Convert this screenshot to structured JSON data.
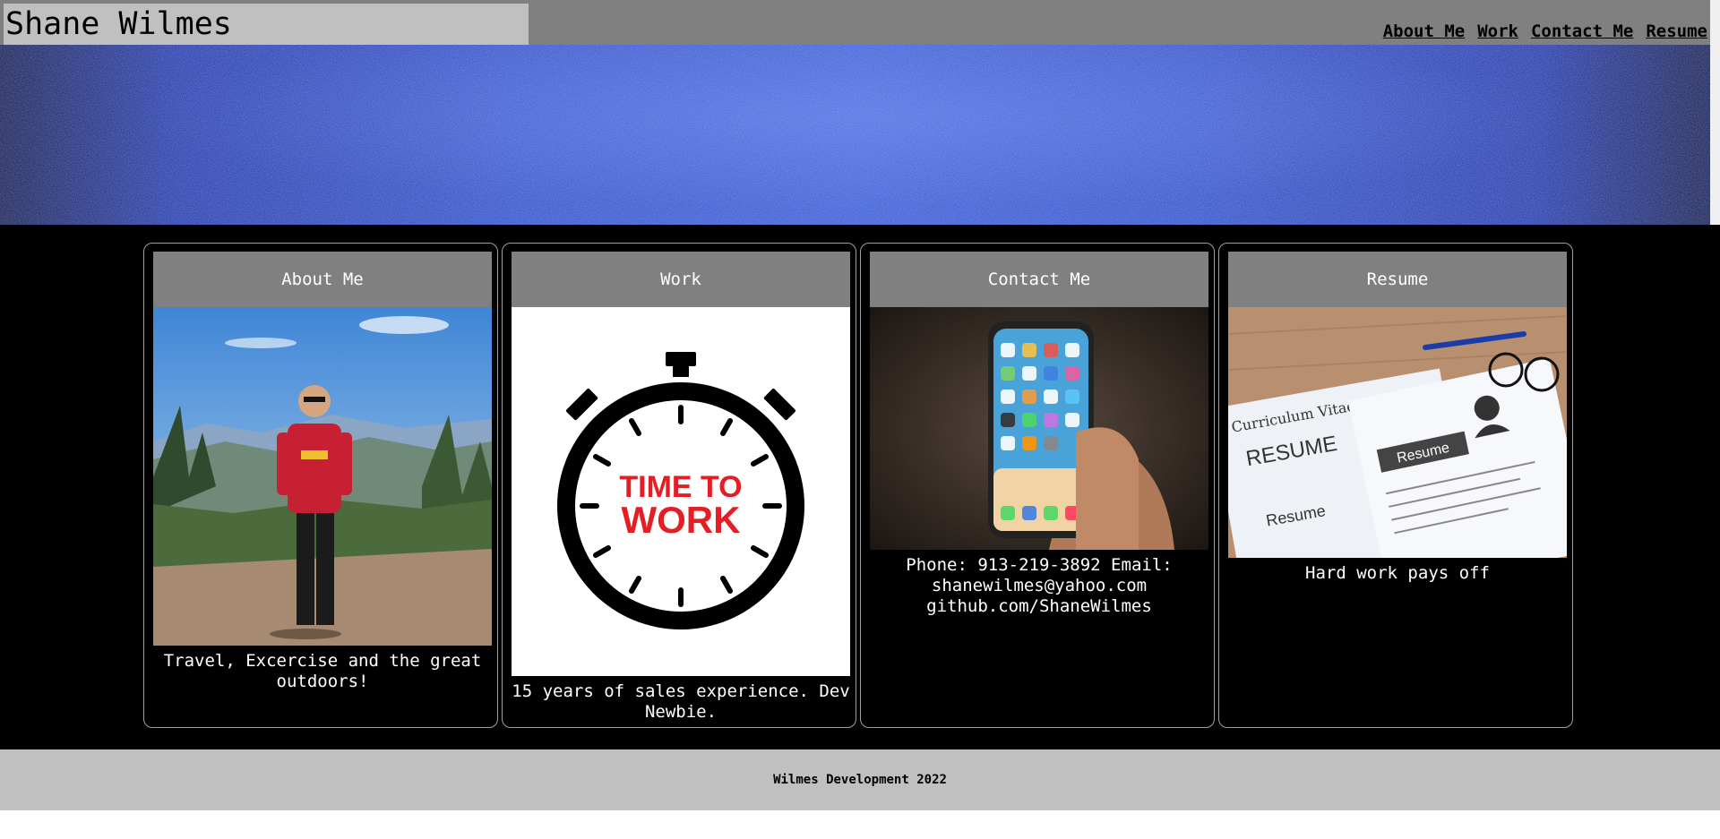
{
  "header": {
    "title": "Shane Wilmes",
    "nav": [
      {
        "label": "About Me"
      },
      {
        "label": "Work"
      },
      {
        "label": "Contact Me"
      },
      {
        "label": "Resume"
      }
    ]
  },
  "cards": [
    {
      "title": "About Me",
      "image": "hiker-on-mountain-photo",
      "text": "Travel, Excercise and the great outdoors!"
    },
    {
      "title": "Work",
      "image": "stopwatch-time-to-work-graphic",
      "stopwatch_text_1": "TIME TO",
      "stopwatch_text_2": "WORK",
      "text": "15 years of sales experience. Dev Newbie."
    },
    {
      "title": "Contact Me",
      "image": "hand-holding-smartphone-photo",
      "text": "Phone: 913-219-3892 Email: shanewilmes@yahoo.com github.com/ShaneWilmes"
    },
    {
      "title": "Resume",
      "image": "resume-papers-photo",
      "resume_text_1": "RESUME",
      "resume_text_2": "Resume",
      "resume_text_3": "Curriculum Vitae",
      "resume_text_4": "Resume",
      "text": "Hard work pays off"
    }
  ],
  "footer": {
    "text": "Wilmes Development 2022"
  },
  "colors": {
    "header_bg": "#808080",
    "title_bg": "#c0c0c0",
    "main_bg": "#000000",
    "card_header_bg": "#808080",
    "footer_bg": "#c0c0c0"
  }
}
